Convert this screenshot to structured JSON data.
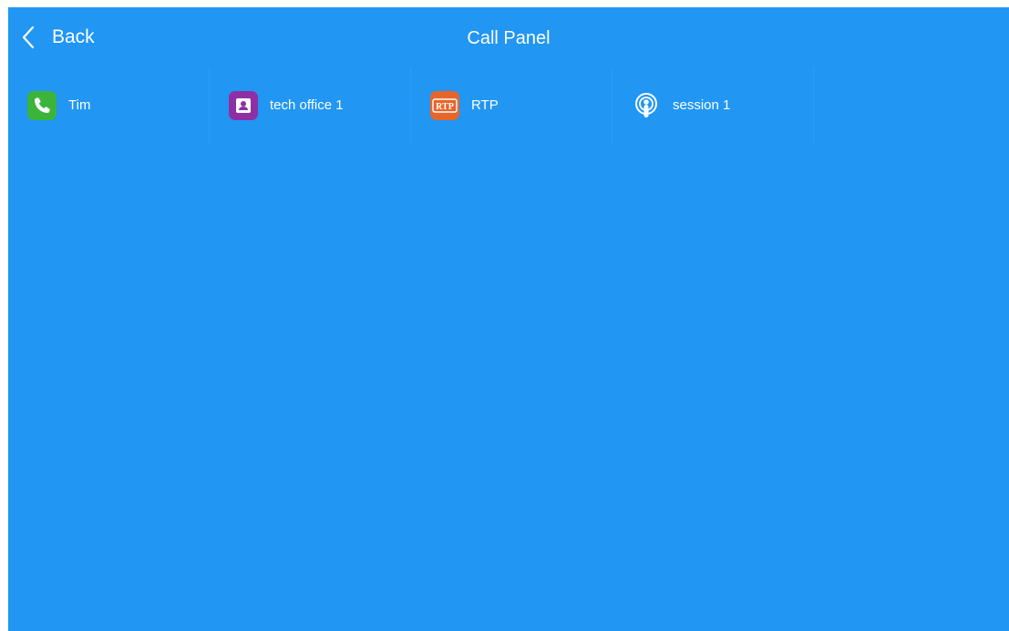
{
  "header": {
    "back_label": "Back",
    "title": "Call Panel"
  },
  "items": [
    {
      "label": "Tim",
      "icon": "phone-icon",
      "color": "#3cb43c"
    },
    {
      "label": "tech office 1",
      "icon": "contact-card-icon",
      "color": "#8e2fa6"
    },
    {
      "label": "RTP",
      "icon": "rtp-icon",
      "icon_text": "RTP",
      "color": "#e8652a"
    },
    {
      "label": "session 1",
      "icon": "broadcast-icon",
      "color": "#ffffff"
    }
  ],
  "colors": {
    "background": "#2196f3",
    "text": "#ffffff"
  }
}
